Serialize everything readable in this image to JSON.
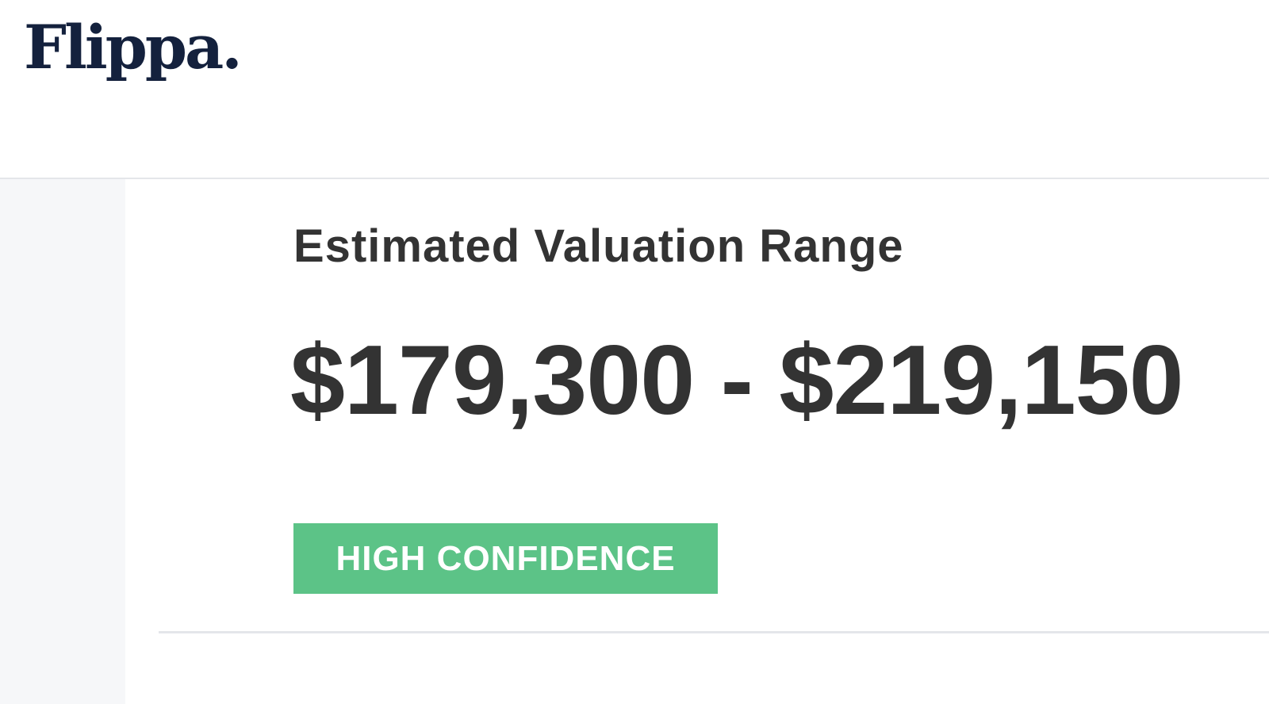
{
  "header": {
    "logo_text": "Flippa."
  },
  "valuation": {
    "label": "Estimated Valuation Range",
    "range": "$179,300 - $219,150",
    "confidence_label": "HIGH CONFIDENCE"
  },
  "colors": {
    "brand_navy": "#14213d",
    "confidence_green": "#5cc387",
    "text_dark": "#333333",
    "sidebar_background": "#f6f7f9",
    "divider": "#e4e6ea"
  }
}
